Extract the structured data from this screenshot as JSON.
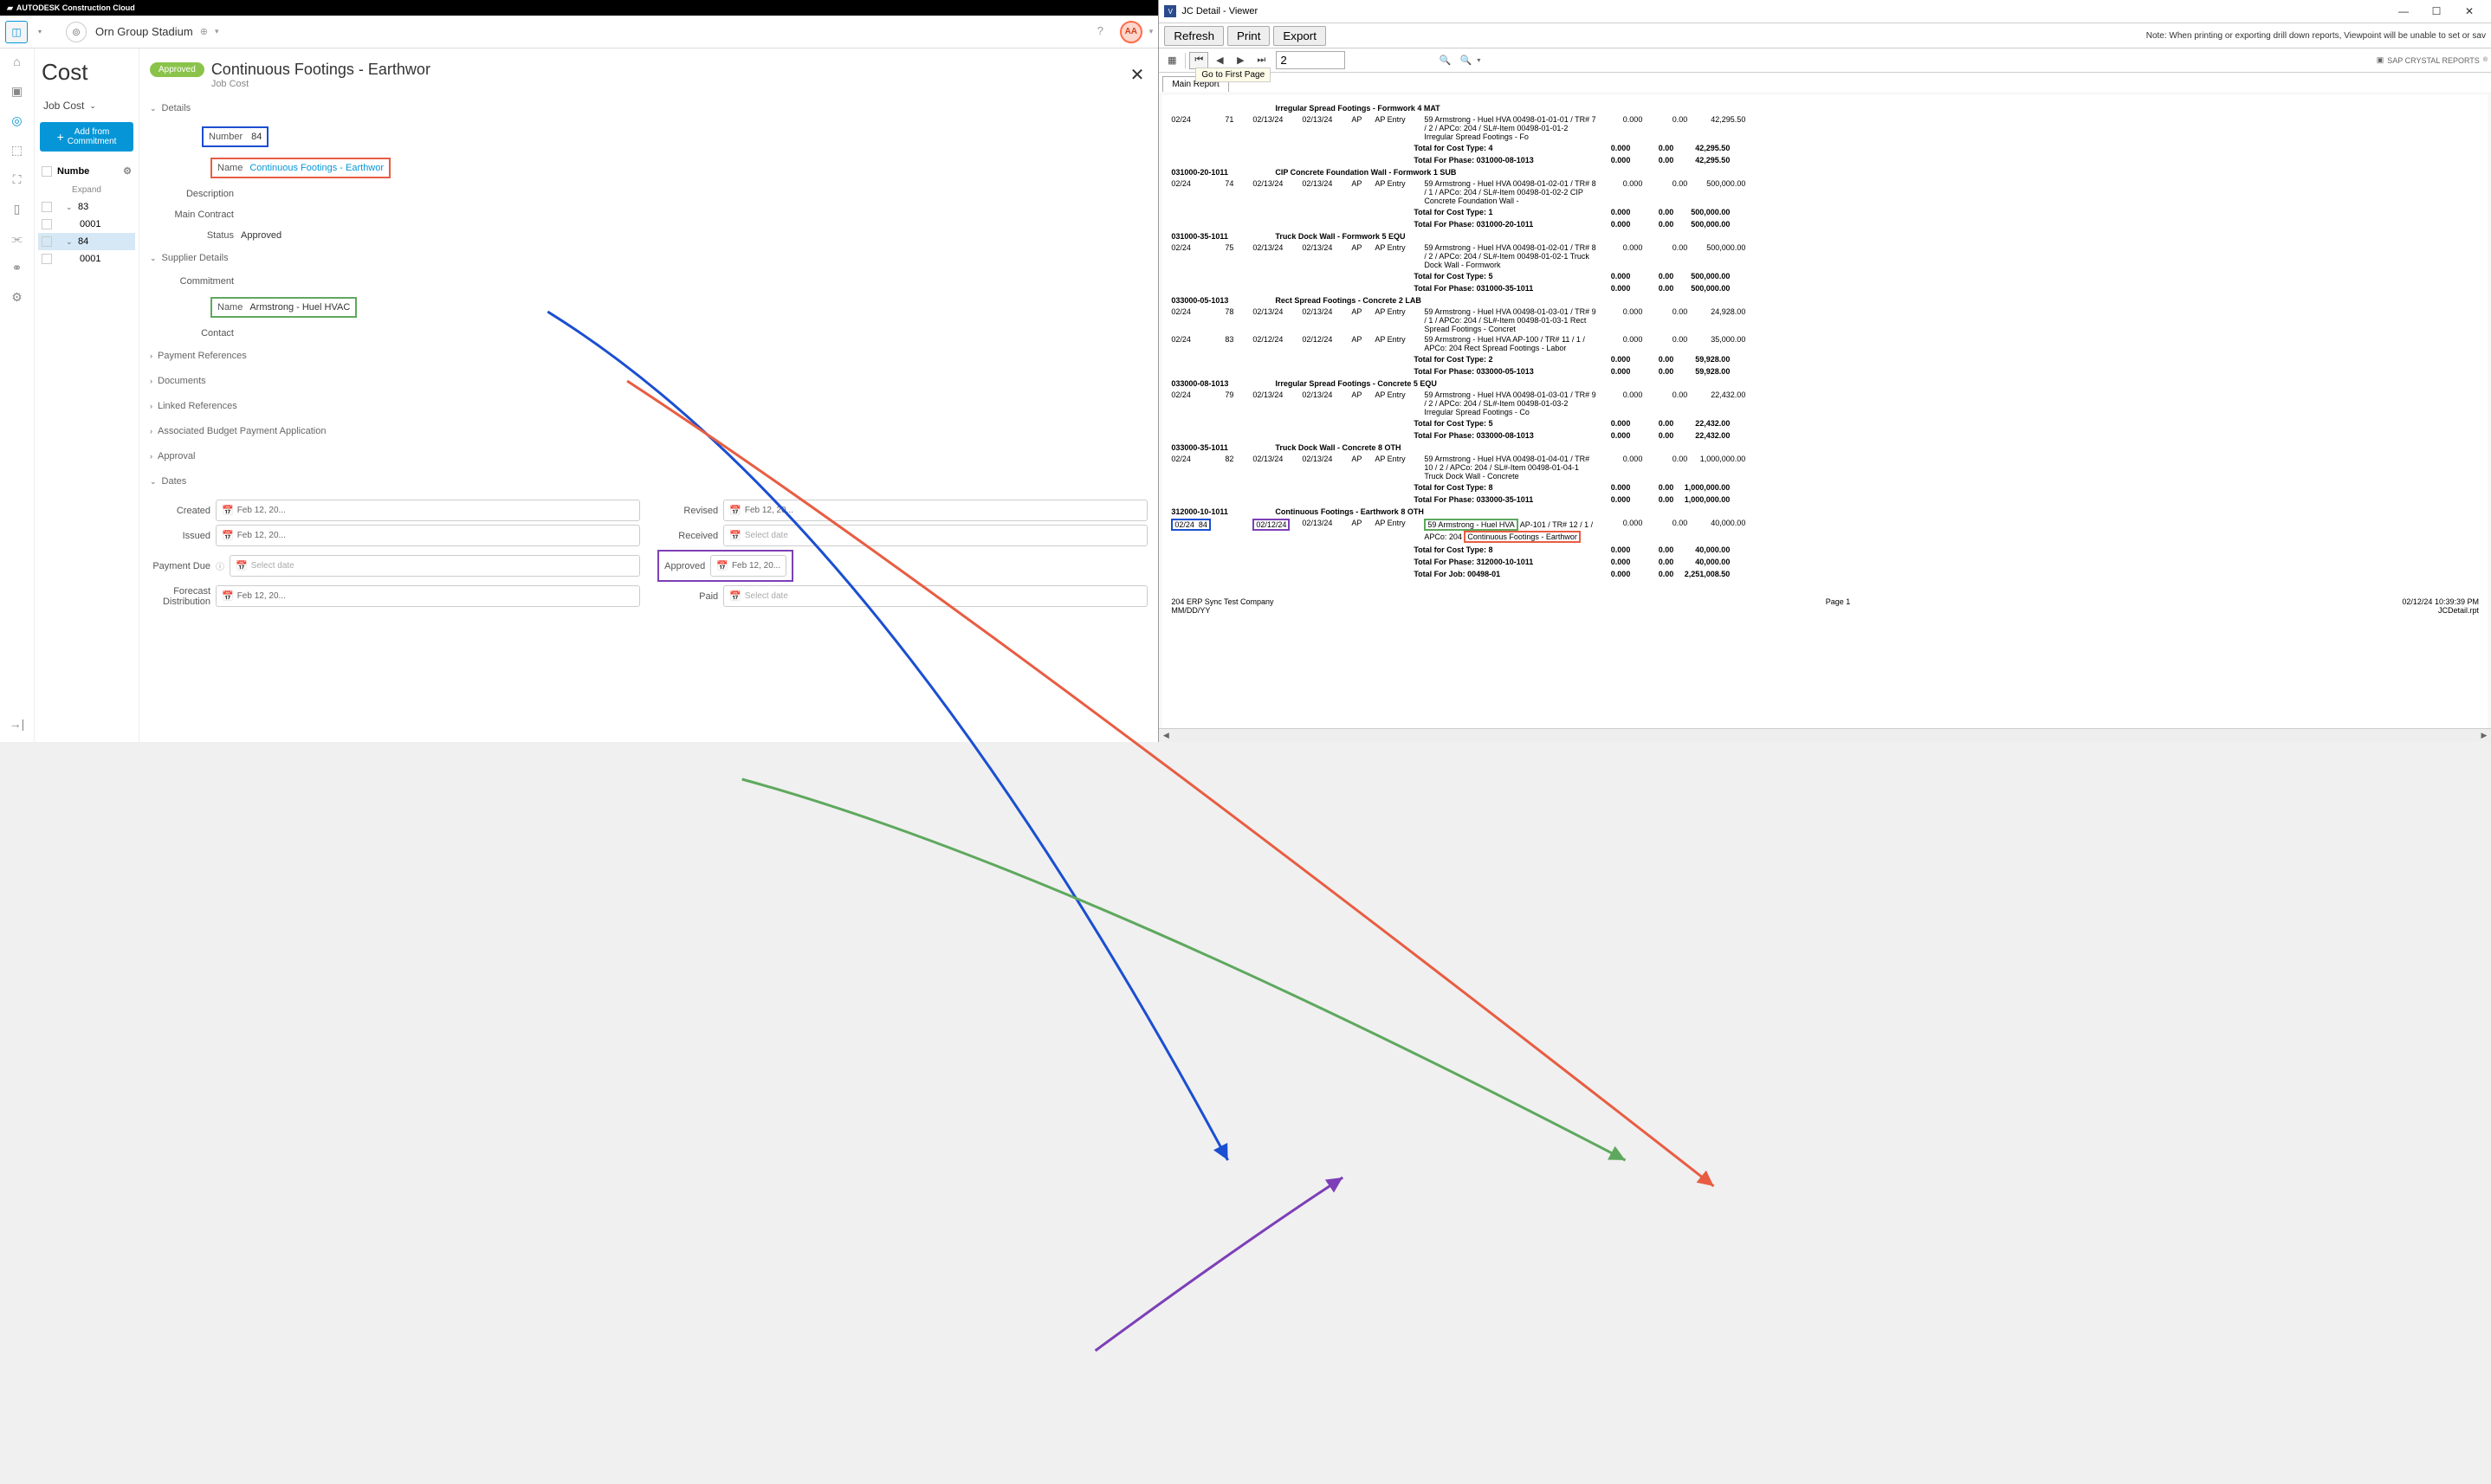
{
  "autodesk": {
    "brand": "AUTODESK Construction Cloud",
    "project": "Orn Group Stadium",
    "avatar": "AA",
    "cost_title": "Cost",
    "jobcost_label": "Job Cost",
    "add_btn_line1": "Add from",
    "add_btn_line2": "Commitment",
    "col_header": "Numbe",
    "expand": "Expand",
    "tree": {
      "n83": "83",
      "n83_child": "0001",
      "n84": "84",
      "n84_child": "0001"
    }
  },
  "detail": {
    "badge": "Approved",
    "title": "Continuous Footings - Earthwor",
    "subtitle": "Job Cost",
    "sections": {
      "details": "Details",
      "supplier": "Supplier Details",
      "payment_refs": "Payment References",
      "documents": "Documents",
      "linked_refs": "Linked References",
      "assoc_budget": "Associated Budget Payment Application",
      "approval": "Approval",
      "dates": "Dates"
    },
    "fields": {
      "number_label": "Number",
      "number_value": "84",
      "name_label": "Name",
      "name_value": "Continuous Footings - Earthwor",
      "description_label": "Description",
      "main_contract_label": "Main Contract",
      "status_label": "Status",
      "status_value": "Approved",
      "commitment_label": "Commitment",
      "supplier_name_label": "Name",
      "supplier_name_value": "Armstrong - Huel HVAC",
      "contact_label": "Contact"
    },
    "dates": {
      "created_label": "Created",
      "created_value": "Feb 12, 20...",
      "issued_label": "Issued",
      "issued_value": "Feb 12, 20...",
      "payment_due_label": "Payment Due",
      "payment_due_value": "Select date",
      "forecast_label": "Forecast Distribution",
      "forecast_value": "Feb 12, 20...",
      "revised_label": "Revised",
      "revised_value": "Feb 12, 20...",
      "received_label": "Received",
      "received_value": "Select date",
      "approved_label": "Approved",
      "approved_value": "Feb 12, 20...",
      "paid_label": "Paid",
      "paid_value": "Select date"
    }
  },
  "viewer": {
    "title": "JC Detail - Viewer",
    "buttons": {
      "refresh": "Refresh",
      "print": "Print",
      "export": "Export"
    },
    "note": "Note: When printing or exporting drill down reports, Viewpoint will be unable to set or sav",
    "page_input": "2",
    "tooltip": "Go to First Page",
    "tab": "Main Report",
    "sap": "SAP CRYSTAL REPORTS",
    "footer": {
      "company": "204 ERP Sync Test Company",
      "dateformat": "MM/DD/YY",
      "page": "Page 1",
      "timestamp": "02/12/24 10:39:39 PM",
      "file": "JCDetail.rpt"
    }
  },
  "report": {
    "rows": [
      {
        "type": "phase",
        "code": "",
        "desc": "Irregular Spread Footings - Formwork  4   MAT"
      },
      {
        "type": "entry",
        "mth": "02/24",
        "trans": "71",
        "act": "02/13/24",
        "post": "02/13/24",
        "src": "AP",
        "jc": "AP Entry",
        "desc": "59 Armstrong - Huel HVA 00498-01-01-01 / TR# 7 / 2 / APCo: 204 / SL#-Item 00498-01-01-2  Irregular Spread Footings - Fo",
        "v1": "0.000",
        "v2": "0.00",
        "v3": "42,295.50"
      },
      {
        "type": "total",
        "label": "Total for Cost Type:  4",
        "v1": "0.000",
        "v2": "0.00",
        "v3": "42,295.50"
      },
      {
        "type": "total",
        "label": "Total For Phase: 031000-08-1013",
        "v1": "0.000",
        "v2": "0.00",
        "v3": "42,295.50"
      },
      {
        "type": "phase",
        "code": "031000-20-1011",
        "desc": "CIP Concrete Foundation Wall - Formwork  1   SUB"
      },
      {
        "type": "entry",
        "mth": "02/24",
        "trans": "74",
        "act": "02/13/24",
        "post": "02/13/24",
        "src": "AP",
        "jc": "AP Entry",
        "desc": "59 Armstrong - Huel HVA 00498-01-02-01 / TR# 8 / 1 / APCo: 204 / SL#-Item 00498-01-02-2  CIP Concrete Foundation Wall -",
        "v1": "0.000",
        "v2": "0.00",
        "v3": "500,000.00"
      },
      {
        "type": "total",
        "label": "Total for Cost Type:  1",
        "v1": "0.000",
        "v2": "0.00",
        "v3": "500,000.00"
      },
      {
        "type": "total",
        "label": "Total For Phase: 031000-20-1011",
        "v1": "0.000",
        "v2": "0.00",
        "v3": "500,000.00"
      },
      {
        "type": "phase",
        "code": "031000-35-1011",
        "desc": "Truck Dock Wall - Formwork  5   EQU"
      },
      {
        "type": "entry",
        "mth": "02/24",
        "trans": "75",
        "act": "02/13/24",
        "post": "02/13/24",
        "src": "AP",
        "jc": "AP Entry",
        "desc": "59 Armstrong - Huel HVA 00498-01-02-01 / TR# 8 / 2 / APCo: 204 / SL#-Item 00498-01-02-1  Truck Dock Wall - Formwork",
        "v1": "0.000",
        "v2": "0.00",
        "v3": "500,000.00"
      },
      {
        "type": "total",
        "label": "Total for Cost Type:  5",
        "v1": "0.000",
        "v2": "0.00",
        "v3": "500,000.00"
      },
      {
        "type": "total",
        "label": "Total For Phase: 031000-35-1011",
        "v1": "0.000",
        "v2": "0.00",
        "v3": "500,000.00"
      },
      {
        "type": "phase",
        "code": "033000-05-1013",
        "desc": "Rect Spread Footings - Concrete  2   LAB"
      },
      {
        "type": "entry",
        "mth": "02/24",
        "trans": "78",
        "act": "02/13/24",
        "post": "02/13/24",
        "src": "AP",
        "jc": "AP Entry",
        "desc": "59 Armstrong - Huel HVA 00498-01-03-01 / TR# 9 / 1 / APCo: 204 / SL#-Item 00498-01-03-1  Rect Spread Footings - Concret",
        "v1": "0.000",
        "v2": "0.00",
        "v3": "24,928.00"
      },
      {
        "type": "entry",
        "mth": "02/24",
        "trans": "83",
        "act": "02/12/24",
        "post": "02/12/24",
        "src": "AP",
        "jc": "AP Entry",
        "desc": "59 Armstrong - Huel HVA AP-100 / TR# 11 / 1 / APCo: 204  Rect Spread Footings - Labor",
        "v1": "0.000",
        "v2": "0.00",
        "v3": "35,000.00"
      },
      {
        "type": "total",
        "label": "Total for Cost Type:  2",
        "v1": "0.000",
        "v2": "0.00",
        "v3": "59,928.00"
      },
      {
        "type": "total",
        "label": "Total For Phase: 033000-05-1013",
        "v1": "0.000",
        "v2": "0.00",
        "v3": "59,928.00"
      },
      {
        "type": "phase",
        "code": "033000-08-1013",
        "desc": "Irregular Spread Footings - Concrete  5   EQU"
      },
      {
        "type": "entry",
        "mth": "02/24",
        "trans": "79",
        "act": "02/13/24",
        "post": "02/13/24",
        "src": "AP",
        "jc": "AP Entry",
        "desc": "59 Armstrong - Huel HVA 00498-01-03-01 / TR# 9 / 2 / APCo: 204 / SL#-Item 00498-01-03-2  Irregular Spread Footings - Co",
        "v1": "0.000",
        "v2": "0.00",
        "v3": "22,432.00"
      },
      {
        "type": "total",
        "label": "Total for Cost Type:  5",
        "v1": "0.000",
        "v2": "0.00",
        "v3": "22,432.00"
      },
      {
        "type": "total",
        "label": "Total For Phase: 033000-08-1013",
        "v1": "0.000",
        "v2": "0.00",
        "v3": "22,432.00"
      },
      {
        "type": "phase",
        "code": "033000-35-1011",
        "desc": "Truck Dock Wall - Concrete  8   OTH"
      },
      {
        "type": "entry",
        "mth": "02/24",
        "trans": "82",
        "act": "02/13/24",
        "post": "02/13/24",
        "src": "AP",
        "jc": "AP Entry",
        "desc": "59 Armstrong - Huel HVA 00498-01-04-01 / TR# 10 / 2 / APCo: 204 / SL#-Item 00498-01-04-1  Truck Dock Wall - Concrete",
        "v1": "0.000",
        "v2": "0.00",
        "v3": "1,000,000.00"
      },
      {
        "type": "total",
        "label": "Total for Cost Type:  8",
        "v1": "0.000",
        "v2": "0.00",
        "v3": "1,000,000.00"
      },
      {
        "type": "total",
        "label": "Total For Phase: 033000-35-1011",
        "v1": "0.000",
        "v2": "0.00",
        "v3": "1,000,000.00"
      },
      {
        "type": "phase",
        "code": "312000-10-1011",
        "desc": "Continuous Footings - Earthwork  8   OTH"
      },
      {
        "type": "highlight_entry",
        "mth": "02/24",
        "trans": "84",
        "act": "02/12/24",
        "post": "02/13/24",
        "src": "AP",
        "jc": "AP Entry",
        "supplier": "59 Armstrong - Huel HVA",
        "ref": "AP-101 / TR# 12 / 1 /",
        "apco": "APCo: 204",
        "item": "Continuous Footings - Earthwor",
        "v1": "0.000",
        "v2": "0.00",
        "v3": "40,000.00"
      },
      {
        "type": "total",
        "label": "Total for Cost Type:  8",
        "v1": "0.000",
        "v2": "0.00",
        "v3": "40,000.00"
      },
      {
        "type": "total",
        "label": "Total For Phase: 312000-10-1011",
        "v1": "0.000",
        "v2": "0.00",
        "v3": "40,000.00"
      },
      {
        "type": "jobtotal",
        "label": "Total For Job: 00498-01",
        "v1": "0.000",
        "v2": "0.00",
        "v3": "2,251,008.50"
      }
    ]
  }
}
